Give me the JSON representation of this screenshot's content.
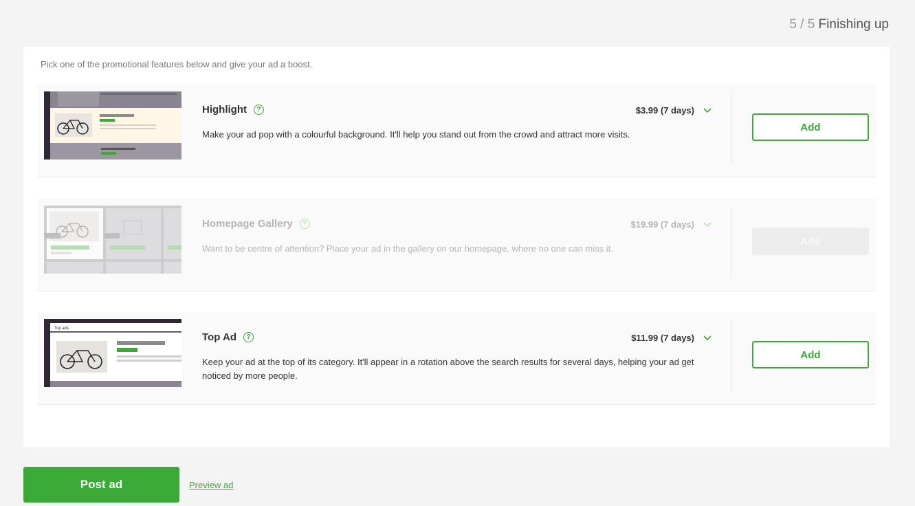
{
  "step": {
    "current": "5",
    "separator": "/",
    "total": "5",
    "label": "Finishing up"
  },
  "intro": "Pick one of the promotional features below and give your ad a boost.",
  "features": [
    {
      "title": "Highlight",
      "price": "$3.99 (7 days)",
      "description": "Make your ad pop with a colourful background. It'll help you stand out from the crowd and attract more visits.",
      "button": "Add",
      "enabled": true
    },
    {
      "title": "Homepage Gallery",
      "price": "$19.99 (7 days)",
      "description": "Want to be centre of attention? Place your ad in the gallery on our homepage, where no one can miss it.",
      "button": "Add",
      "enabled": false
    },
    {
      "title": "Top Ad",
      "price": "$11.99 (7 days)",
      "description": "Keep your ad at the top of its category. It'll appear in a rotation above the search results for several days, helping your ad get noticed by more people.",
      "button": "Add",
      "enabled": true,
      "thumb_label": "Top ads"
    }
  ],
  "help_glyph": "?",
  "footer": {
    "post_label": "Post ad",
    "preview_label": "Preview ad"
  },
  "colors": {
    "accent": "#3aa935",
    "background": "#f4f4f4"
  }
}
